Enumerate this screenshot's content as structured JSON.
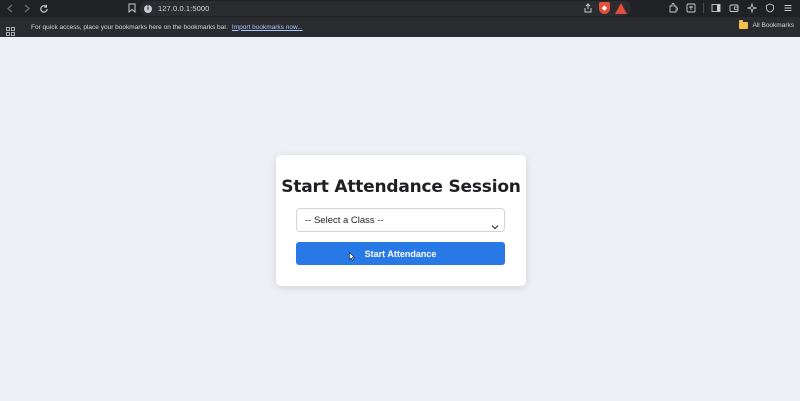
{
  "browser": {
    "url": "127.0.0.1:5000",
    "bookmarks_bar": {
      "message": "For quick access, place your bookmarks here on the bookmarks bar.",
      "import_link": "Import bookmarks now...",
      "all_bookmarks": "All Bookmarks"
    }
  },
  "page": {
    "title": "Start Attendance Session",
    "class_select": {
      "selected": "-- Select a Class --"
    },
    "start_button_label": "Start Attendance"
  },
  "colors": {
    "page_background": "#eef0f5",
    "button": "#2879e6",
    "chrome": "#202124"
  }
}
